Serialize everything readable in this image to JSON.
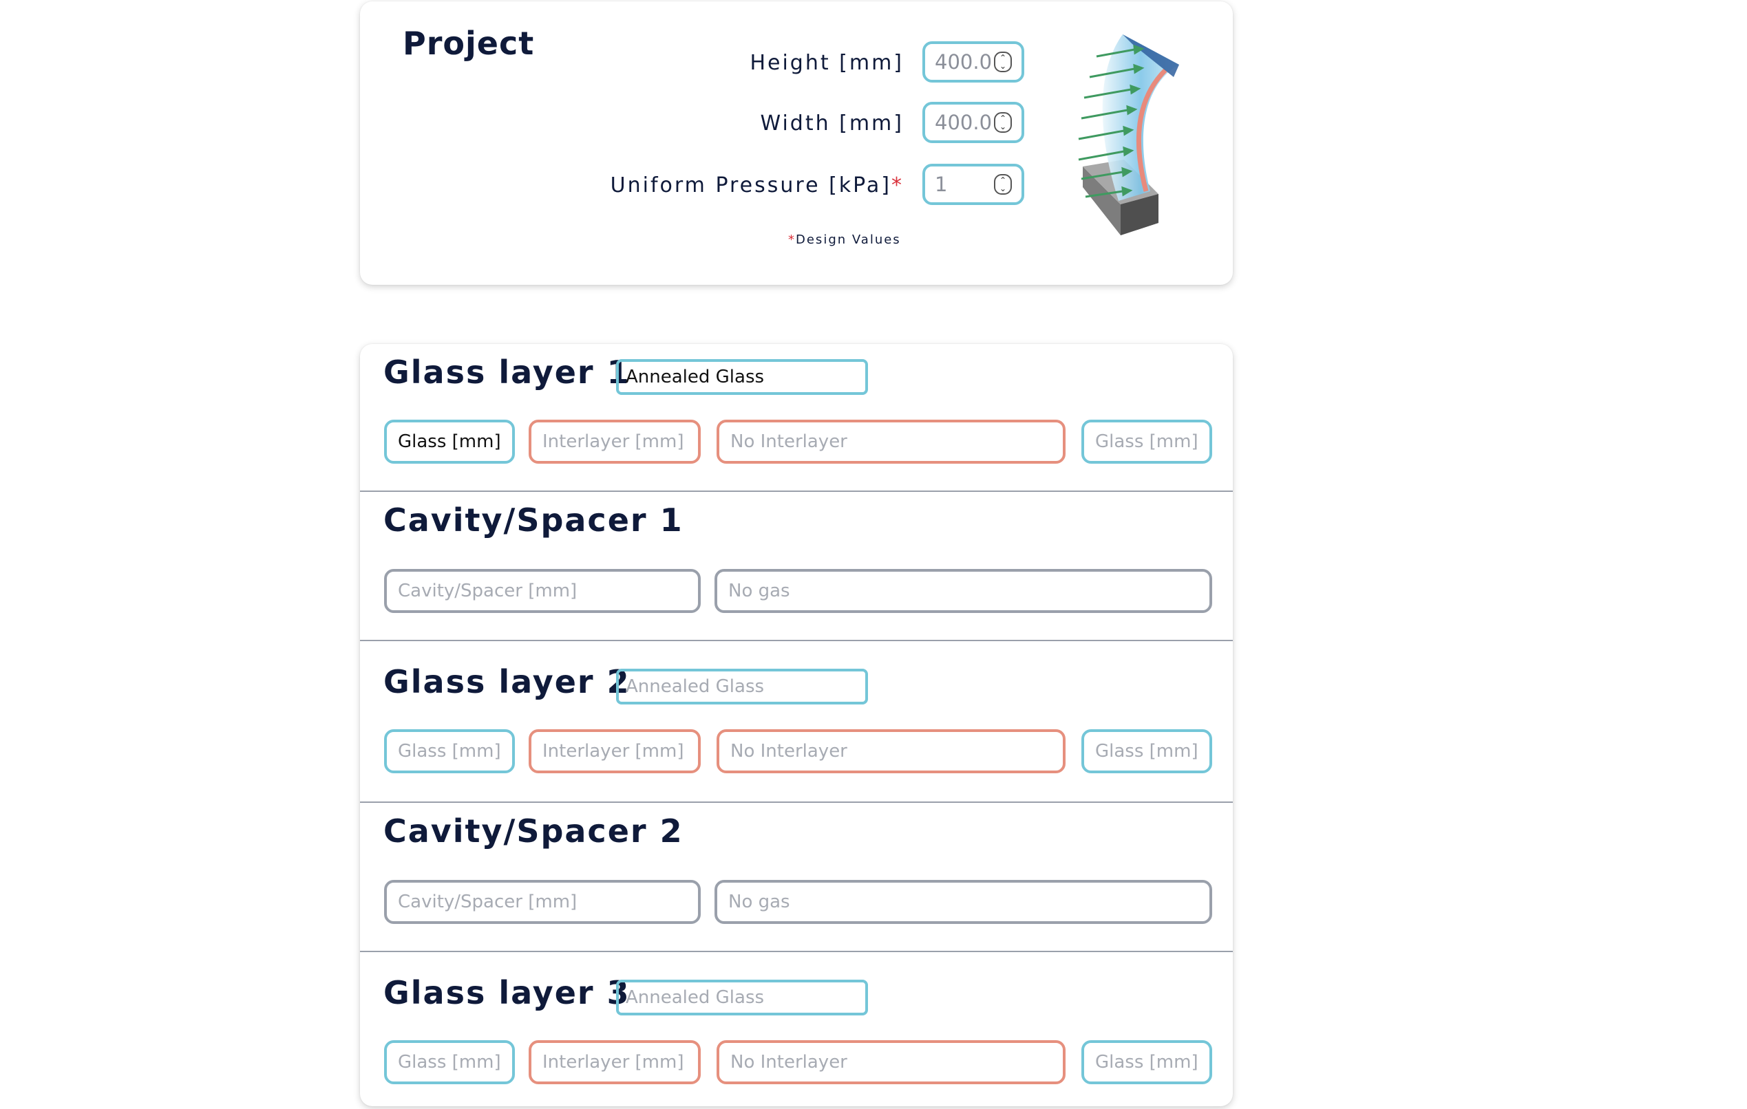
{
  "project": {
    "title": "Project",
    "height_label": "Height [mm]",
    "height_value": "400.0",
    "width_label": "Width [mm]",
    "width_value": "400.0",
    "pressure_label": "Uniform Pressure [kPa]",
    "pressure_required": "*",
    "pressure_value": "1",
    "design_note_marker": "*",
    "design_note": "Design Values"
  },
  "layers": [
    {
      "title": "Glass layer 1",
      "type_value": "Annealed Glass",
      "glass1_placeholder": "Glass [mm]",
      "interlayer_placeholder": "Interlayer [mm]",
      "interlayer_type": "No Interlayer",
      "glass2_placeholder": "Glass [mm]"
    },
    {
      "title": "Cavity/Spacer 1",
      "cavity_placeholder": "Cavity/Spacer [mm]",
      "gas_type": "No gas"
    },
    {
      "title": "Glass layer 2",
      "type_value": "Annealed Glass",
      "glass1_placeholder": "Glass [mm]",
      "interlayer_placeholder": "Interlayer [mm]",
      "interlayer_type": "No Interlayer",
      "glass2_placeholder": "Glass [mm]"
    },
    {
      "title": "Cavity/Spacer 2",
      "cavity_placeholder": "Cavity/Spacer [mm]",
      "gas_type": "No gas"
    },
    {
      "title": "Glass layer 3",
      "type_value": "Annealed Glass",
      "glass1_placeholder": "Glass [mm]",
      "interlayer_placeholder": "Interlayer [mm]",
      "interlayer_type": "No Interlayer",
      "glass2_placeholder": "Glass [mm]"
    }
  ],
  "colors": {
    "glass_border": "#74c6d8",
    "interlayer_border": "#e6907e",
    "cavity_border": "#9aa0ab",
    "heading": "#0f1a3a",
    "required_marker": "#d9303a"
  },
  "icons": {
    "illustration": "bent-glass-pressure-illustration",
    "spinner": "spin-up-down-icon"
  }
}
